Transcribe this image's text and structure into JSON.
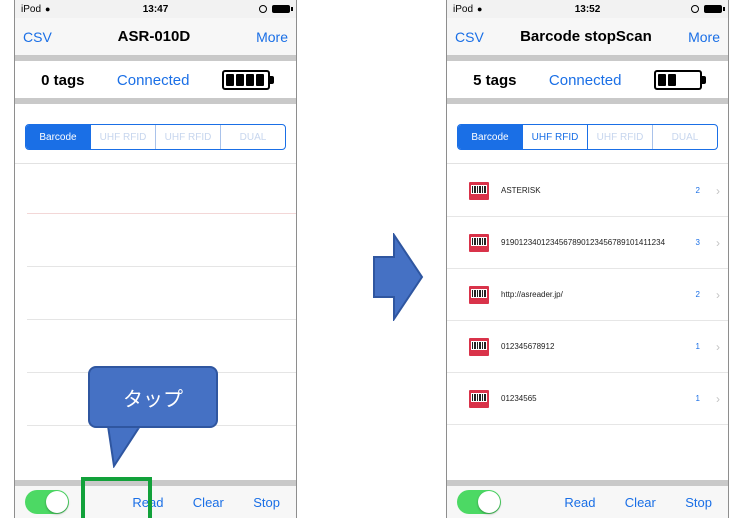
{
  "colors": {
    "accent": "#1a6fe6",
    "switch_on": "#4cd964",
    "callout": "#4571c4",
    "highlight_box": "#12a13a",
    "arrow": "#4571c4",
    "barcode_icon": "#d9334a"
  },
  "left": {
    "status": {
      "carrier": "iPod",
      "wifi_icon": "wifi-icon",
      "time": "13:47"
    },
    "nav": {
      "left": "CSV",
      "title": "ASR-010D",
      "right": "More"
    },
    "info": {
      "tags": "0 tags",
      "connection": "Connected",
      "battery_cells_filled": 4,
      "battery_cells_total": 4
    },
    "tabs": [
      {
        "label": "Barcode",
        "state": "active"
      },
      {
        "label": "UHF RFID",
        "state": "disabled"
      },
      {
        "label": "UHF RFID",
        "state": "disabled"
      },
      {
        "label": "DUAL",
        "state": "disabled"
      }
    ],
    "toolbar": {
      "read": "Read",
      "clear": "Clear",
      "stop": "Stop",
      "switch_on": true
    }
  },
  "right": {
    "status": {
      "carrier": "iPod",
      "wifi_icon": "wifi-icon",
      "time": "13:52"
    },
    "nav": {
      "left": "CSV",
      "title": "Barcode stopScan",
      "right": "More"
    },
    "info": {
      "tags": "5 tags",
      "connection": "Connected",
      "battery_cells_filled": 2,
      "battery_cells_total": 4
    },
    "tabs": [
      {
        "label": "Barcode",
        "state": "active"
      },
      {
        "label": "UHF RFID",
        "state": "normal"
      },
      {
        "label": "UHF RFID",
        "state": "disabled"
      },
      {
        "label": "DUAL",
        "state": "disabled"
      }
    ],
    "rows": [
      {
        "text": "ASTERISK",
        "count": "2"
      },
      {
        "text": "9190123401234567890123456789101411234",
        "count": "3"
      },
      {
        "text": "http://asreader.jp/",
        "count": "2"
      },
      {
        "text": "012345678912",
        "count": "1"
      },
      {
        "text": "01234565",
        "count": "1"
      }
    ],
    "toolbar": {
      "read": "Read",
      "clear": "Clear",
      "stop": "Stop",
      "switch_on": true
    }
  },
  "callout": {
    "text": "タップ"
  }
}
